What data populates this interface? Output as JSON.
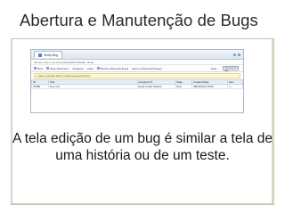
{
  "slide": {
    "title": "Abertura e Manutenção de Bugs",
    "caption": "A tela edição de um bug é similar a tela de uma história ou de um teste."
  },
  "screenshot": {
    "tab_label": "Verify Bug",
    "path": "Tecnico test.corp.com/toolbar[SOFTWARE] - Build",
    "toolbar_items": [
      "New",
      "Save Work Item",
      "Assigned",
      "Links",
      "Send to Microsoft Excel",
      "Open in Microsoft Project"
    ],
    "view_label": "View:",
    "view_value": "Assigned to me",
    "info_text": "1 Query contains links to advanced search items",
    "columns": [
      "ID",
      "Title",
      "Assigned To",
      "State",
      "Created Date",
      "Rev"
    ],
    "rows": [
      {
        "id": "13685",
        "title": "Bug Title",
        "assigned": "Rosa Cortez Santos",
        "state": "New",
        "date": "08/10/2010 10:00",
        "rev": "1"
      }
    ]
  },
  "colors": {
    "accent": "#5b83b5",
    "rule": "#c8c3b2"
  }
}
